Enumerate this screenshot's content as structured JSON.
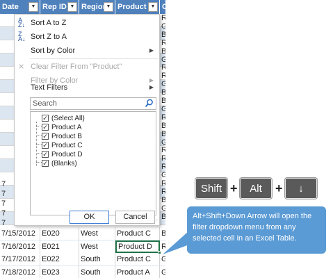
{
  "header": {
    "columns": [
      "Date",
      "Rep ID",
      "Region",
      "Product",
      "C"
    ]
  },
  "left_partial": [
    "7",
    "7",
    "7",
    "7",
    "7"
  ],
  "right_partial": [
    "R",
    "G",
    "B",
    "R",
    "B",
    "G",
    "R",
    "R",
    "G",
    "B",
    "B",
    "G",
    "R",
    "B",
    "B",
    "G",
    "R",
    "R",
    "R",
    "G",
    "R",
    "R",
    "B",
    "G",
    "B"
  ],
  "rows": [
    {
      "date": "7/15/2012",
      "rep": "E020",
      "region": "West",
      "product": "Product C",
      "c": "B"
    },
    {
      "date": "7/16/2012",
      "rep": "E021",
      "region": "West",
      "product": "Product D",
      "c": "R"
    },
    {
      "date": "7/17/2012",
      "rep": "E022",
      "region": "South",
      "product": "Product C",
      "c": "G"
    },
    {
      "date": "7/18/2012",
      "rep": "E023",
      "region": "South",
      "product": "Product A",
      "c": "G"
    }
  ],
  "menu": {
    "sort_az": "Sort A to Z",
    "sort_za": "Sort Z to A",
    "sort_color": "Sort by Color",
    "clear_filter": "Clear Filter From \"Product\"",
    "filter_color": "Filter by Color",
    "text_filters": "Text Filters",
    "search_placeholder": "Search",
    "items": [
      "(Select All)",
      "Product A",
      "Product B",
      "Product C",
      "Product D",
      "(Blanks)"
    ],
    "ok": "OK",
    "cancel": "Cancel"
  },
  "keys": [
    "Shift",
    "Alt",
    "↓"
  ],
  "plus": "+",
  "callout": "Alt+Shift+Down Arrow will open the filter dropdown menu from any selected cell in an Excel Table.",
  "colors": {
    "header": "#4f81bd",
    "band": "#dce6f1",
    "selection": "#217346",
    "key": "#5a5a5a",
    "callout": "#5b9bd5"
  }
}
